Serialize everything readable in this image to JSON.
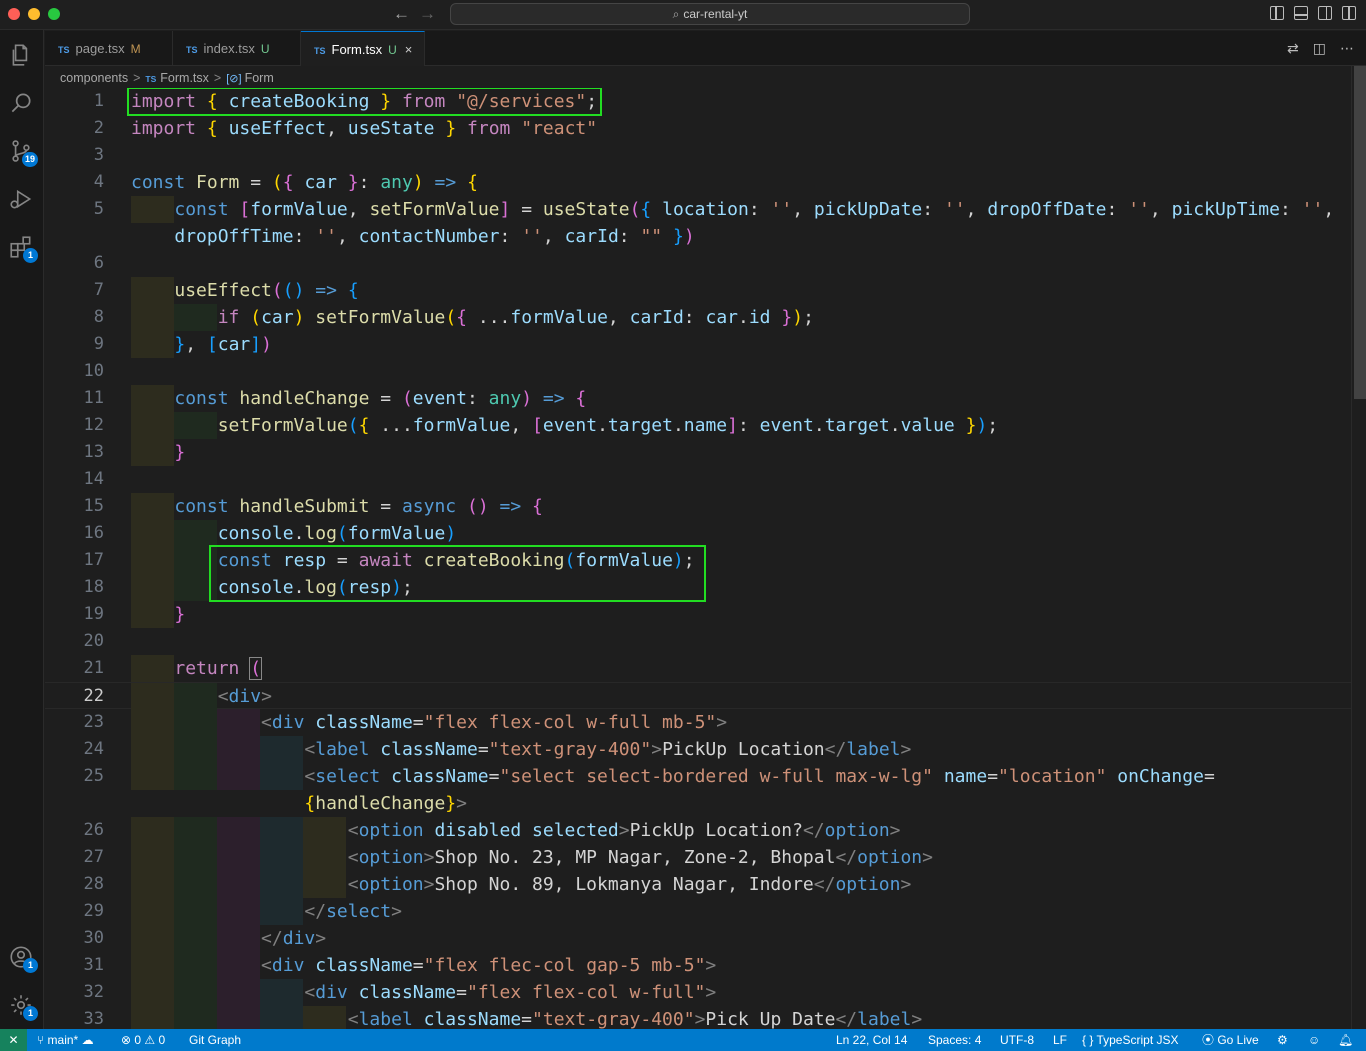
{
  "window": {
    "title": "car-rental-yt"
  },
  "activity": {
    "source_control_badge": "19",
    "extensions_badge": "1",
    "accounts_badge": "1",
    "settings_badge": "1"
  },
  "tabs": [
    {
      "lang": "TS",
      "label": "page.tsx",
      "mark": "M"
    },
    {
      "lang": "TS",
      "label": "index.tsx",
      "mark": "U"
    },
    {
      "lang": "TS",
      "label": "Form.tsx",
      "mark": "U",
      "close": "×"
    }
  ],
  "breadcrumb": {
    "folder": "components",
    "file_lang": "TS",
    "file": "Form.tsx",
    "symbol_icon": "[⊘]",
    "symbol": "Form",
    "sep": ">"
  },
  "line_numbers": [
    "1",
    "2",
    "3",
    "4",
    "5",
    "",
    "6",
    "7",
    "8",
    "9",
    "10",
    "11",
    "12",
    "13",
    "14",
    "15",
    "16",
    "17",
    "18",
    "19",
    "20",
    "21",
    "22",
    "23",
    "24",
    "25",
    "",
    "26",
    "27",
    "28",
    "29",
    "30",
    "31",
    "32",
    "33"
  ],
  "current_line": "22",
  "status": {
    "branch": "main*",
    "errors": "0",
    "warnings": "0",
    "git_graph": "Git Graph",
    "position": "Ln 22, Col 14",
    "spaces": "Spaces: 4",
    "encoding": "UTF-8",
    "eol": "LF",
    "language": "TypeScript JSX",
    "go_live": "Go Live"
  },
  "colors": {
    "status_bar": "#007acc",
    "highlight_box": "#22dd22",
    "accent": "#0078d4"
  }
}
